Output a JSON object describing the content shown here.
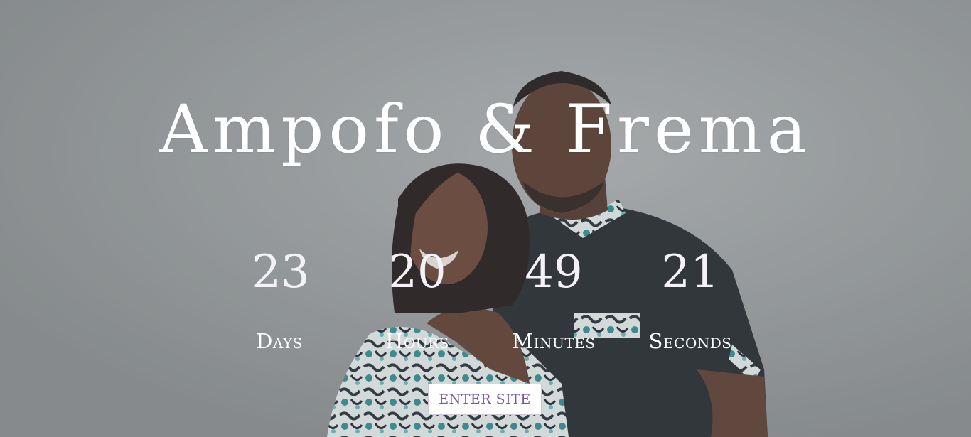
{
  "title": "Ampofo & Frema",
  "countdown": [
    {
      "value": "23",
      "label": "Days"
    },
    {
      "value": "20",
      "label": "Hours"
    },
    {
      "value": "49",
      "label": "Minutes"
    },
    {
      "value": "21",
      "label": "Seconds"
    }
  ],
  "enter_button": "ENTER SITE",
  "colors": {
    "background": "#979b9c",
    "text": "#ffffff",
    "button_text": "#7a58a8",
    "button_bg": "#ffffff"
  }
}
